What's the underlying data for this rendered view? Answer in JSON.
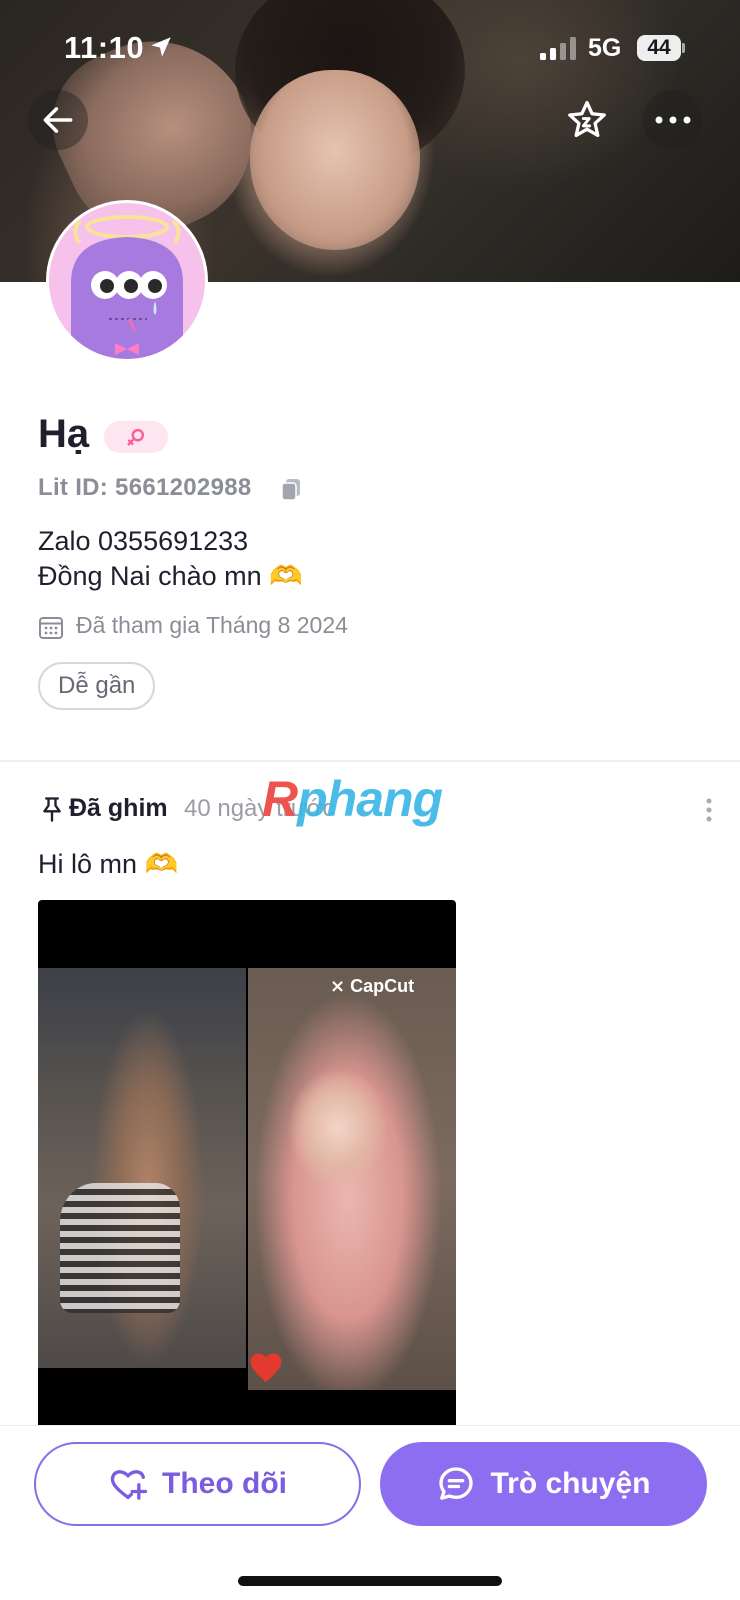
{
  "status_bar": {
    "time": "11:10",
    "network": "5G",
    "battery": "44",
    "battery_level_percent": 44
  },
  "header": {
    "back_icon": "arrow-left-icon",
    "favorite_icon": "star-add-icon",
    "more_icon": "ellipsis-horizontal-icon"
  },
  "profile": {
    "name": "Hạ",
    "gender_icon": "female-symbol-icon",
    "lit_id": "Lit ID: 5661202988",
    "bio_line_1": "Zalo 0355691233",
    "bio_line_2": "Đồng Nai chào mn 🫶",
    "joined": "Đã tham gia Tháng 8 2024",
    "tag": "Dễ gần"
  },
  "post": {
    "pinned_label": "Đã ghim",
    "time": "40 ngày trước",
    "text": "Hi lô mn 🫶",
    "media_watermark": "CapCut"
  },
  "watermark": {
    "first": "R",
    "rest": "phang"
  },
  "actions": {
    "follow_label": "Theo dõi",
    "chat_label": "Trò chuyện"
  },
  "colors": {
    "accent": "#8e6ef0",
    "accent_text": "#7b5ce0",
    "muted_text": "#8b8d97",
    "gender_badge_bg": "#fde6ef",
    "avatar_bg": "#f6c1ea"
  }
}
